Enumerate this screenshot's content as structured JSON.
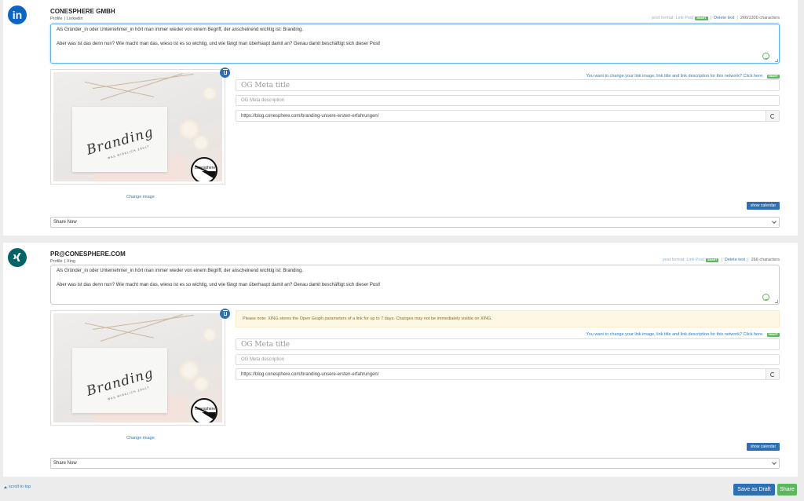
{
  "accounts": [
    {
      "name": "CONESPHERE GMBH",
      "type": "Profile",
      "network": "Linkedin",
      "icon": "linkedin-icon",
      "post_format": "post format: Link Post",
      "smart_badge": "SMART",
      "delete_text": "Delete text",
      "char_count": "266/1300 characters",
      "text_line1": "Als Gründer_in oder Unternehmer_in hört man immer wieder von einem Begriff, der anscheinend wichtig ist: Branding.",
      "text_line2": "Aber was ist das denn nun? Wie macht man das, wieso ist es so wichtig, und wie fängt man überhaupt damit an? Genau damit beschäftigt sich dieser Post!",
      "change_image": "Change image",
      "og_hint": "You want to change your link image, link title and link description for this network? Click here.",
      "og_title_placeholder": "OG Meta title",
      "og_desc_placeholder": "OG Meta description",
      "og_url": "https://blog.conesphere.com/branding-unsere-ersten-erfahrungen/",
      "show_calendar": "show calendar",
      "share_option": "Share Now"
    },
    {
      "name": "PR@CONESPHERE.COM",
      "type": "Profile",
      "network": "Xing",
      "icon": "xing-icon",
      "post_format": "post format: Link Post",
      "smart_badge": "SMART",
      "delete_text": "Delete text",
      "char_count": "266 characters",
      "text_line1": "Als Gründer_in oder Unternehmer_in hört man immer wieder von einem Begriff, der anscheinend wichtig ist: Branding.",
      "text_line2": "Aber was ist das denn nun? Wie macht man das, wieso ist es so wichtig, und wie fängt man überhaupt damit an? Genau damit beschäftigt sich dieser Post!",
      "notice": "Please note: XING stores the Open Graph parameters of a link for up to 7 days. Changes may not be immediately visible on XING.",
      "change_image": "Change image",
      "og_hint": "You want to change your link image, link title and link description for this network? Click here.",
      "og_title_placeholder": "OG Meta title",
      "og_desc_placeholder": "OG Meta description",
      "og_url": "https://blog.conesphere.com/branding-unsere-ersten-erfahrungen/",
      "show_calendar": "show calendar",
      "share_option": "Share Now"
    }
  ],
  "image": {
    "script_text": "Branding",
    "sub_text": "WAS WIRKLICH ZÄHLT",
    "logo_text": "conesphere"
  },
  "footer": {
    "scroll_top": "scroll to top",
    "save_draft": "Save as Draft",
    "share": "Share"
  },
  "colors": {
    "primary": "#2f6fb3",
    "success": "#5cb85c",
    "linkedin": "#0a66c2",
    "xing": "#026466"
  }
}
